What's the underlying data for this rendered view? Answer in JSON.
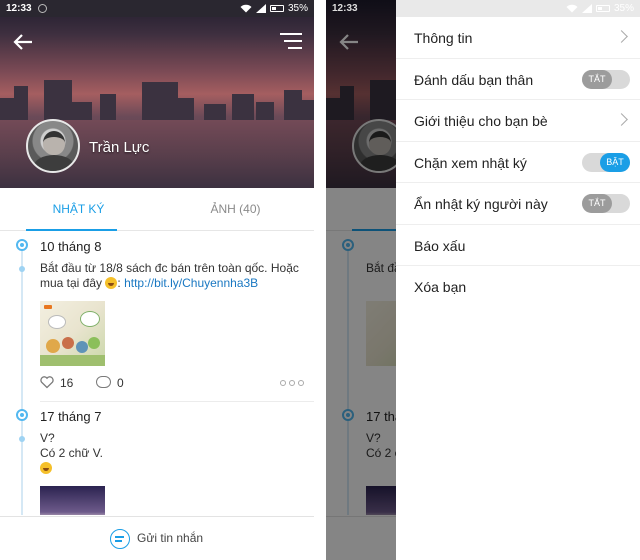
{
  "status_bar": {
    "time": "12:33",
    "battery": "35%"
  },
  "profile": {
    "name": "Trần Lực"
  },
  "tabs": [
    {
      "label": "NHẬT KÝ",
      "active": true
    },
    {
      "label": "ẢNH (40)",
      "active": false
    }
  ],
  "posts": [
    {
      "date": "10 tháng 8",
      "text_line1": "Bắt đầu từ 18/8 sách đc bán trên toàn qốc. Hoặc",
      "text_line2_prefix": "mua tại đây",
      "text_line2_sep": ":",
      "link": "http://bit.ly/Chuyennha3B",
      "likes": "16",
      "comments": "0"
    },
    {
      "date": "17 tháng 7",
      "line1": "V?",
      "line2": "Có 2 chữ V."
    }
  ],
  "bottom_bar": {
    "label": "Gửi tin nhắn"
  },
  "menu": [
    {
      "label": "Thông tin",
      "control": "chevron"
    },
    {
      "label": "Đánh dấu bạn thân",
      "control": "toggle",
      "state": "TẮT"
    },
    {
      "label": "Giới thiệu cho bạn bè",
      "control": "chevron"
    },
    {
      "label": "Chặn xem nhật ký",
      "control": "toggle",
      "state": "BẬT"
    },
    {
      "label": "Ẩn nhật ký người này",
      "control": "toggle",
      "state": "TẮT"
    },
    {
      "label": "Báo xấu",
      "control": "none"
    },
    {
      "label": "Xóa bạn",
      "control": "none"
    }
  ],
  "colors": {
    "accent": "#1a9ee6",
    "link": "#1a78c2",
    "timeline": "#53b8f0"
  },
  "icons": [
    "back-arrow-icon",
    "menu-icon",
    "heart-icon",
    "comment-icon",
    "more-icon",
    "chat-icon",
    "chevron-right-icon",
    "wifi-icon",
    "signal-icon",
    "battery-icon"
  ]
}
